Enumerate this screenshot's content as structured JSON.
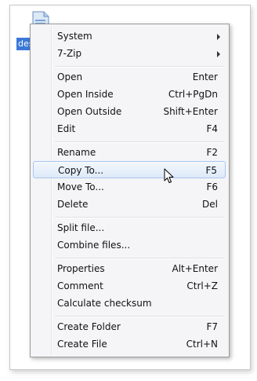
{
  "desktop": {
    "file_label": "des",
    "icon": "document-icon"
  },
  "context_menu": {
    "items": [
      {
        "label": "System",
        "submenu": true
      },
      {
        "label": "7-Zip",
        "submenu": true
      },
      {
        "label": "Open",
        "shortcut": "Enter"
      },
      {
        "label": "Open Inside",
        "shortcut": "Ctrl+PgDn"
      },
      {
        "label": "Open Outside",
        "shortcut": "Shift+Enter"
      },
      {
        "label": "Edit",
        "shortcut": "F4"
      },
      {
        "label": "Rename",
        "shortcut": "F2"
      },
      {
        "label": "Copy To...",
        "shortcut": "F5",
        "highlighted": true
      },
      {
        "label": "Move To...",
        "shortcut": "F6"
      },
      {
        "label": "Delete",
        "shortcut": "Del"
      },
      {
        "label": "Split file..."
      },
      {
        "label": "Combine files..."
      },
      {
        "label": "Properties",
        "shortcut": "Alt+Enter"
      },
      {
        "label": "Comment",
        "shortcut": "Ctrl+Z"
      },
      {
        "label": "Calculate checksum"
      },
      {
        "label": "Create Folder",
        "shortcut": "F7"
      },
      {
        "label": "Create File",
        "shortcut": "Ctrl+N"
      }
    ]
  },
  "colors": {
    "selection_blue": "#3b78d8",
    "highlight_border": "#a8c7ee",
    "menu_background": "#f5f5f7"
  },
  "cursor": "arrow-pointer-icon"
}
